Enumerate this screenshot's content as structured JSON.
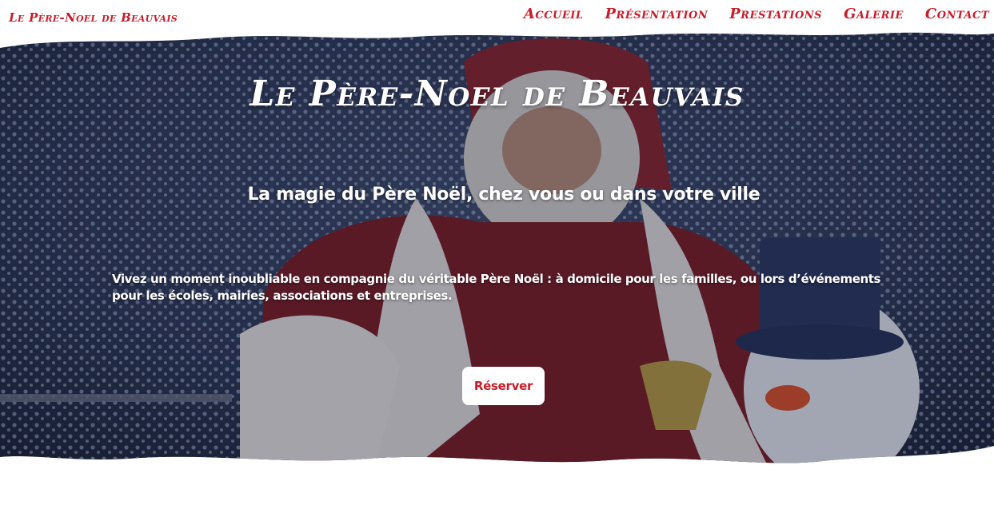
{
  "header": {
    "brand": "Le Père-Noel de Beauvais",
    "nav": [
      {
        "label": "Accueil"
      },
      {
        "label": "Présentation"
      },
      {
        "label": "Prestations"
      },
      {
        "label": "Galerie"
      },
      {
        "label": "Contact"
      }
    ]
  },
  "hero": {
    "title": "Le Père-Noel de Beauvais",
    "subtitle": "La magie du Père Noël, chez vous ou dans votre ville",
    "description": "Vivez un moment inoubliable en compagnie du véritable Père Noël : à domicile pour les familles, ou lors d’événements pour les écoles, mairies, associations et entreprises.",
    "button_label": "Réserver"
  },
  "colors": {
    "accent": "#c81c2a",
    "hero_overlay": "#1c2540",
    "button_bg": "#ffffff"
  },
  "icons": {
    "hero_image": "santa-claus-photo"
  }
}
